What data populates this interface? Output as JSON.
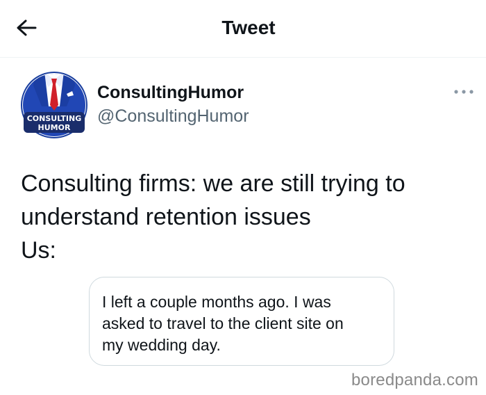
{
  "header": {
    "title": "Tweet",
    "back_icon": "arrow-left-icon"
  },
  "author": {
    "display_name": "ConsultingHumor",
    "handle": "@ConsultingHumor",
    "avatar": {
      "line1": "CONSULTING",
      "line2": "HUMOR",
      "colors": {
        "ring": "#1a3f9f",
        "suit": "#2147b5",
        "tie": "#d0202b",
        "banner": "#1a2d6b"
      }
    },
    "more_icon": "more-dots-icon"
  },
  "tweet": {
    "lines": [
      "Consulting firms: we are still trying to",
      "understand retention issues",
      "Us:"
    ]
  },
  "quote": {
    "lines": [
      "I left a couple months ago. I was",
      "asked to travel to the client site on",
      "my wedding day."
    ]
  },
  "watermark": "boredpanda.com",
  "colors": {
    "text": "#0f1419",
    "secondary_text": "#536471",
    "border": "#cfd9de"
  }
}
